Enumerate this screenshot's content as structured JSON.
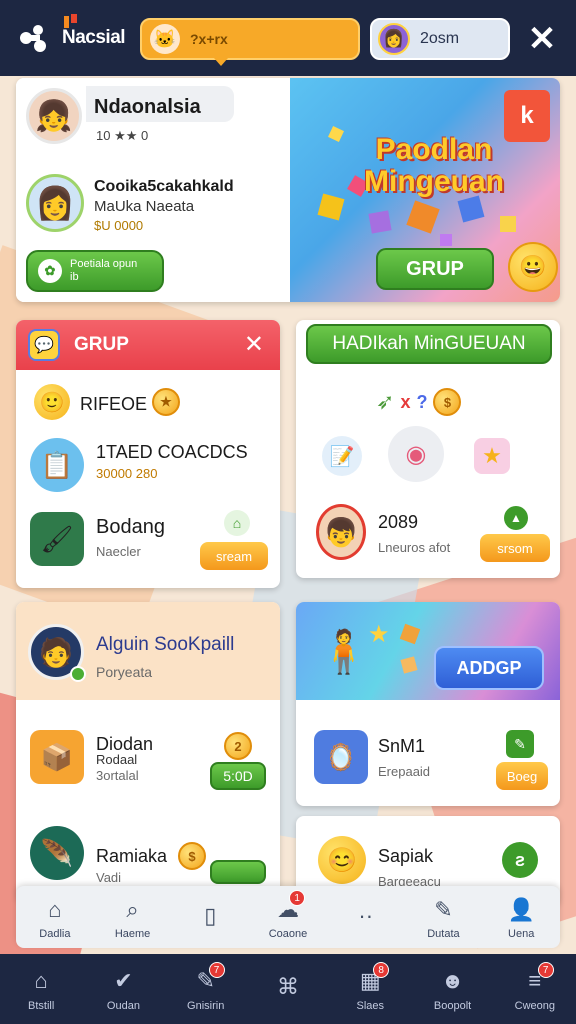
{
  "app": {
    "title": "Nacsial"
  },
  "search": {
    "text": "?x+rx"
  },
  "user": {
    "name": "2osm"
  },
  "hero": {
    "title_line1": "Paodlan",
    "title_line2": "Mingeuan",
    "btn_grup": "GRUP",
    "top_profile": {
      "name": "Ndaonalsia",
      "meta": "10 ★★ 0"
    },
    "second_profile": {
      "name": "Cooika5cakahkald",
      "line2": "MaUka Naeata",
      "line3": "$U 0000"
    },
    "green_button": {
      "line1": "Poetiala opun",
      "line2": "ib"
    }
  },
  "grup_card": {
    "title": "GRUP",
    "rows": [
      {
        "title": "RIFEOE",
        "sub": "",
        "icon": "smile-icon"
      },
      {
        "title": "1TAED COACDCS",
        "sub": "30000 280",
        "icon": "phone-icon"
      },
      {
        "title": "Bodang",
        "sub": "Naecler",
        "button": "sream",
        "icon": "brush-icon"
      }
    ]
  },
  "hadiah_card": {
    "title": "HADIkah MinGUEUAN",
    "row": {
      "title": "2089",
      "sub": "Lneuros afot",
      "button": "srsom"
    }
  },
  "profile_card": {
    "name": "Alguin SooKpaill",
    "sub": "Poryeata",
    "rows": [
      {
        "title": "Diodan",
        "line2": "Rodaal",
        "line3": "3ortalal",
        "badge": "2",
        "button": "5:0D"
      },
      {
        "title": "Ramiaka",
        "line2": "Vadi",
        "badge": "",
        "button": ""
      }
    ]
  },
  "promo_card": {
    "button": "ADDGP",
    "row": {
      "title": "SnM1",
      "sub": "Erepaaid",
      "button": "Boeg"
    }
  },
  "sapiak_card": {
    "title": "Sapiak",
    "sub": "Bargeeacu"
  },
  "nav": [
    {
      "label": "Dadlia",
      "icon": "home-icon",
      "badge": ""
    },
    {
      "label": "Haeme",
      "icon": "search-icon",
      "badge": ""
    },
    {
      "label": "",
      "icon": "device-icon",
      "badge": ""
    },
    {
      "label": "Coaone",
      "icon": "chat-icon",
      "badge": "1"
    },
    {
      "label": "",
      "icon": "dots-icon",
      "badge": ""
    },
    {
      "label": "Dutata",
      "icon": "tag-icon",
      "badge": ""
    },
    {
      "label": "Uena",
      "icon": "user-icon",
      "badge": ""
    }
  ],
  "bottom": [
    {
      "label": "Btstill",
      "icon": "home-icon",
      "badge": ""
    },
    {
      "label": "Oudan",
      "icon": "check-icon",
      "badge": ""
    },
    {
      "label": "Gnisirin",
      "icon": "pen-icon",
      "badge": "7"
    },
    {
      "label": "",
      "icon": "paw-icon",
      "badge": ""
    },
    {
      "label": "Slaes",
      "icon": "calendar-icon",
      "badge": "8"
    },
    {
      "label": "Boopolt",
      "icon": "face-icon",
      "badge": ""
    },
    {
      "label": "Cweong",
      "icon": "menu-icon",
      "badge": "7"
    }
  ],
  "colors": {
    "topbar": "#1d2742",
    "accent_orange": "#f7a928",
    "accent_green": "#4cae34",
    "accent_red": "#e9414b"
  }
}
